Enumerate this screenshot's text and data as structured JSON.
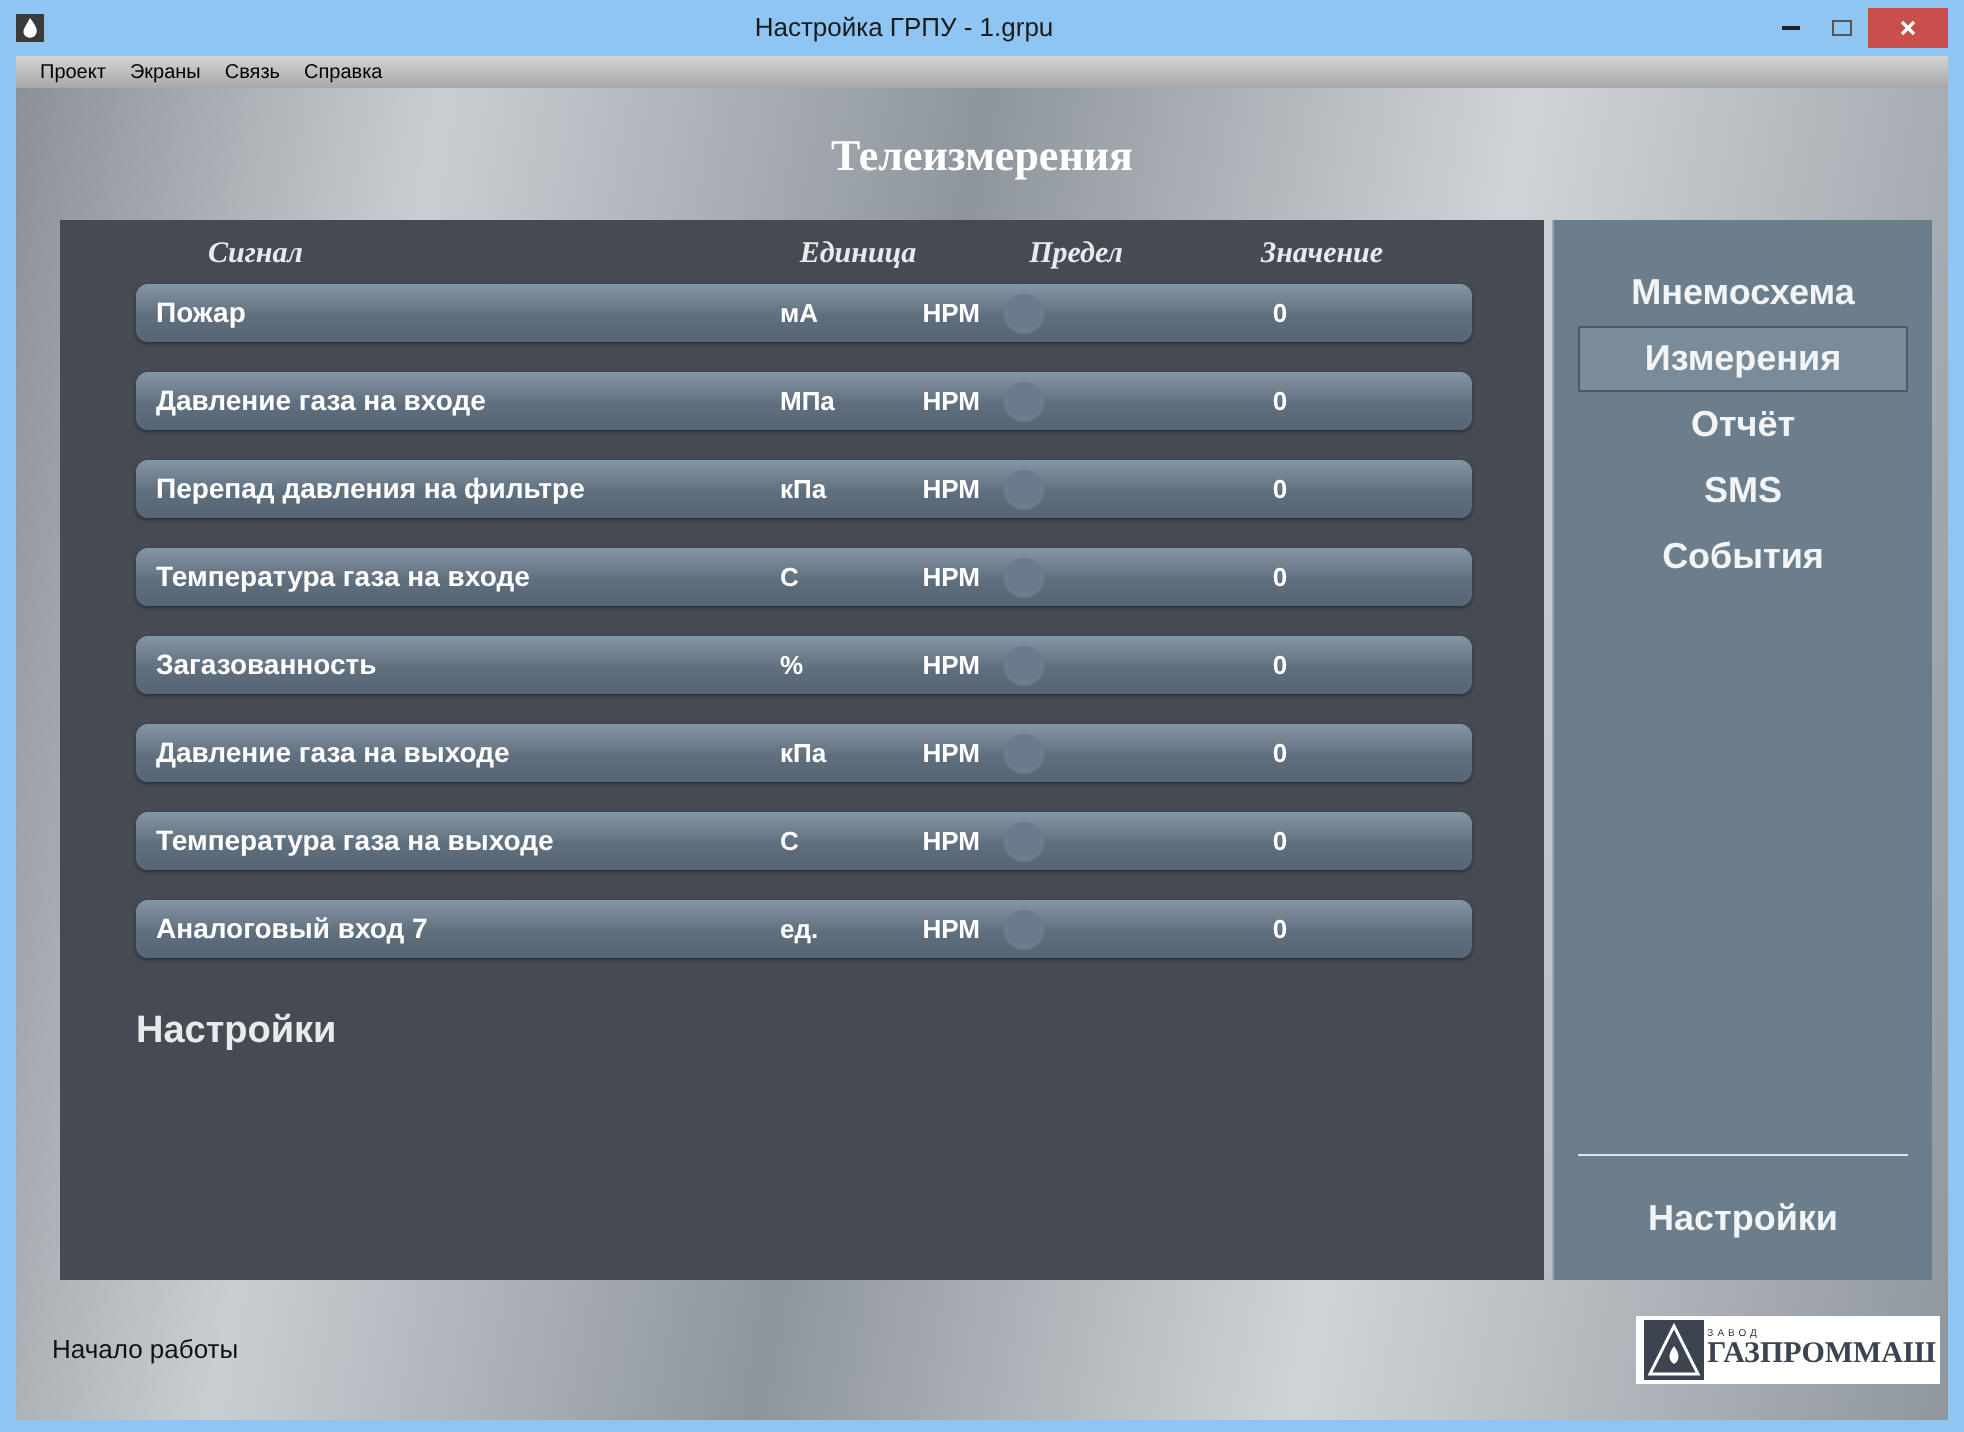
{
  "window": {
    "title": "Настройка ГРПУ - 1.grpu"
  },
  "menu": [
    "Проект",
    "Экраны",
    "Связь",
    "Справка"
  ],
  "heading": "Телеизмерения",
  "table": {
    "columns": [
      "Сигнал",
      "Единица",
      "Предел",
      "Значение"
    ],
    "rows": [
      {
        "signal": "Пожар",
        "unit": "мА",
        "limit": "НРМ",
        "value": "0"
      },
      {
        "signal": "Давление газа на входе",
        "unit": "МПа",
        "limit": "НРМ",
        "value": "0"
      },
      {
        "signal": "Перепад давления на фильтре",
        "unit": "кПа",
        "limit": "НРМ",
        "value": "0"
      },
      {
        "signal": "Температура газа на входе",
        "unit": "С",
        "limit": "НРМ",
        "value": "0"
      },
      {
        "signal": "Загазованность",
        "unit": "%",
        "limit": "НРМ",
        "value": "0"
      },
      {
        "signal": "Давление газа на выходе",
        "unit": "кПа",
        "limit": "НРМ",
        "value": "0"
      },
      {
        "signal": "Температура газа на выходе",
        "unit": "С",
        "limit": "НРМ",
        "value": "0"
      },
      {
        "signal": "Аналоговый вход 7",
        "unit": "ед.",
        "limit": "НРМ",
        "value": "0"
      }
    ]
  },
  "settings_label": "Настройки",
  "nav": {
    "items": [
      {
        "label": "Мнемосхема",
        "selected": false
      },
      {
        "label": "Измерения",
        "selected": true
      },
      {
        "label": "Отчёт",
        "selected": false
      },
      {
        "label": "SMS",
        "selected": false
      },
      {
        "label": "События",
        "selected": false
      }
    ],
    "bottom": "Настройки"
  },
  "status_bar": "Начало работы",
  "logo": {
    "small": "ЗАВОД",
    "name": "ГАЗПРОММАШ"
  }
}
